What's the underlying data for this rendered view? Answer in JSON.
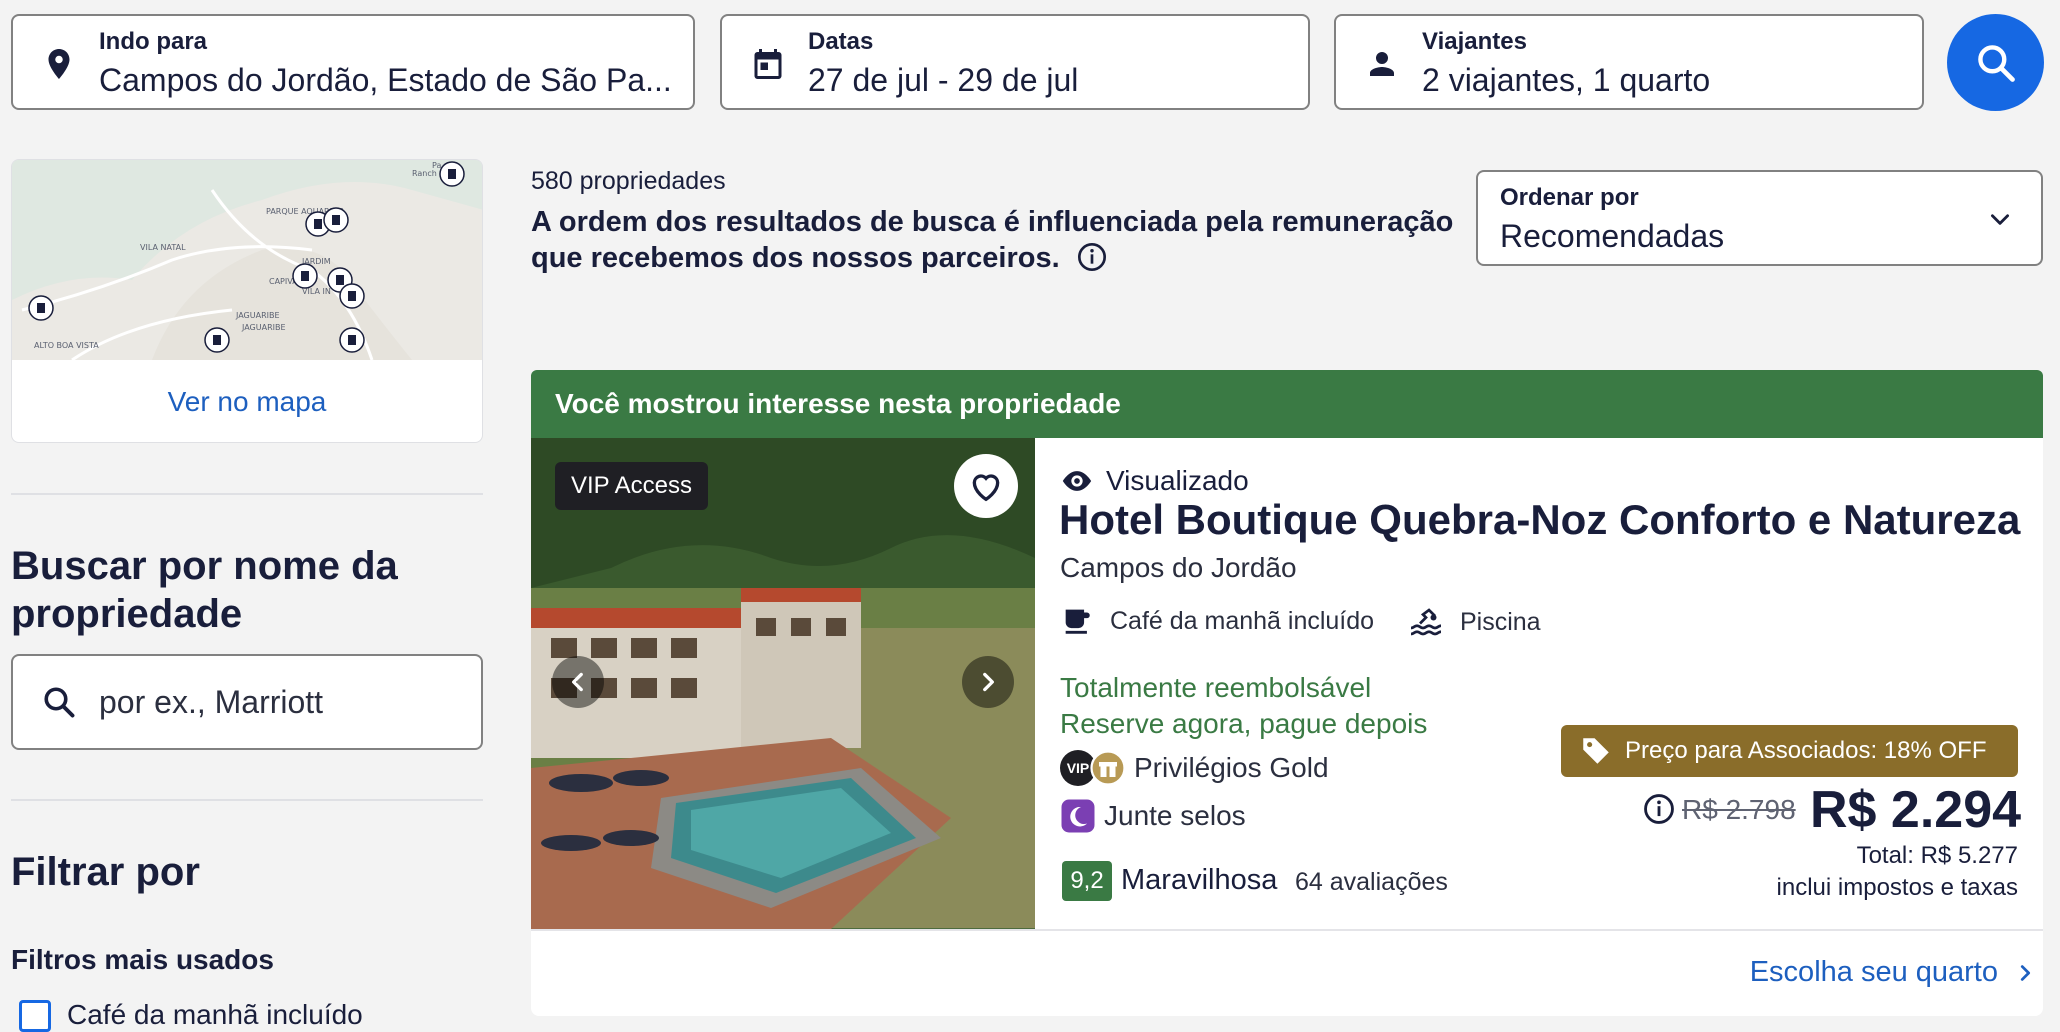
{
  "search": {
    "destination": {
      "label": "Indo para",
      "value": "Campos do Jordão, Estado de São Pa..."
    },
    "dates": {
      "label": "Datas",
      "value": "27 de jul - 29 de jul"
    },
    "travelers": {
      "label": "Viajantes",
      "value": "2 viajantes, 1 quarto"
    }
  },
  "sidebar": {
    "map": {
      "link": "Ver no mapa",
      "labels": [
        "PARQUE AQUARELA",
        "VILA NATAL",
        "CAPIVARI",
        "JARDIM",
        "VILA IN",
        "JAGUARIBE",
        "JAGUARIBE",
        "ALTO BOA VISTA",
        "Pa",
        "Ranch"
      ]
    },
    "name_search": {
      "heading": "Buscar por nome da propriedade",
      "placeholder": "por ex., Marriott"
    },
    "filters": {
      "heading": "Filtrar por",
      "subheading": "Filtros mais usados",
      "options": [
        {
          "label": "Café da manhã incluído"
        }
      ]
    }
  },
  "results": {
    "count": "580 propriedades",
    "disclaimer": "A ordem dos resultados de busca é influenciada pela remuneração que recebemos dos nossos parceiros.",
    "sort": {
      "label": "Ordenar por",
      "value": "Recomendadas"
    }
  },
  "property": {
    "banner": "Você mostrou interesse nesta propriedade",
    "badge": "VIP Access",
    "viewed": "Visualizado",
    "name": "Hotel Boutique Quebra-Noz Conforto e Natureza",
    "location": "Campos do Jordão",
    "amenities": [
      "Café da manhã incluído",
      "Piscina"
    ],
    "refundable": "Totalmente reembolsável",
    "pay_later": "Reserve agora, pague depois",
    "vip_icon_text": "VIP",
    "gold": "Privilégios Gold",
    "stamps": "Junte selos",
    "rating": {
      "score": "9,2",
      "word": "Maravilhosa",
      "count": "64 avaliações"
    },
    "member_deal": "Preço para Associados: 18% OFF",
    "old_price": "R$ 2.798",
    "price": "R$ 2.294",
    "total": "Total: R$ 5.277",
    "taxes": "inclui impostos e taxas",
    "cta": "Escolha seu quarto"
  },
  "colors": {
    "accent": "#1668e3",
    "banner_green": "#3a7a44",
    "member_gold": "#8a6d2a",
    "link_blue": "#1d5fbf"
  }
}
